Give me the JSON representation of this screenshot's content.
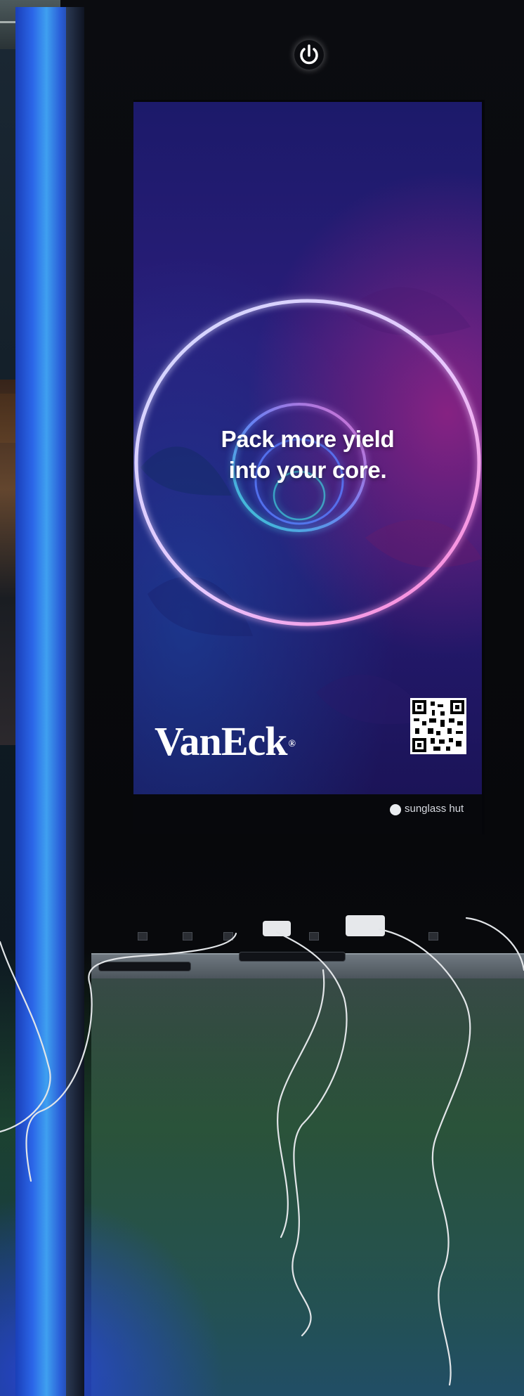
{
  "headline": {
    "line1": "Pack more yield",
    "line2": "into your core."
  },
  "brand": {
    "name": "VanEck",
    "mark": "®"
  },
  "host": {
    "label": "sunglass hut"
  },
  "icons": [
    "power-icon",
    "qr-code",
    "sunglass-hut-dot"
  ],
  "colors": {
    "pillar_blue": "#2b66e8",
    "screen_purple": "#2a1d7a",
    "neon_ring": "#d9c8ff",
    "neon_pink": "#d2288c",
    "neon_cyan": "#3fd6e0"
  }
}
